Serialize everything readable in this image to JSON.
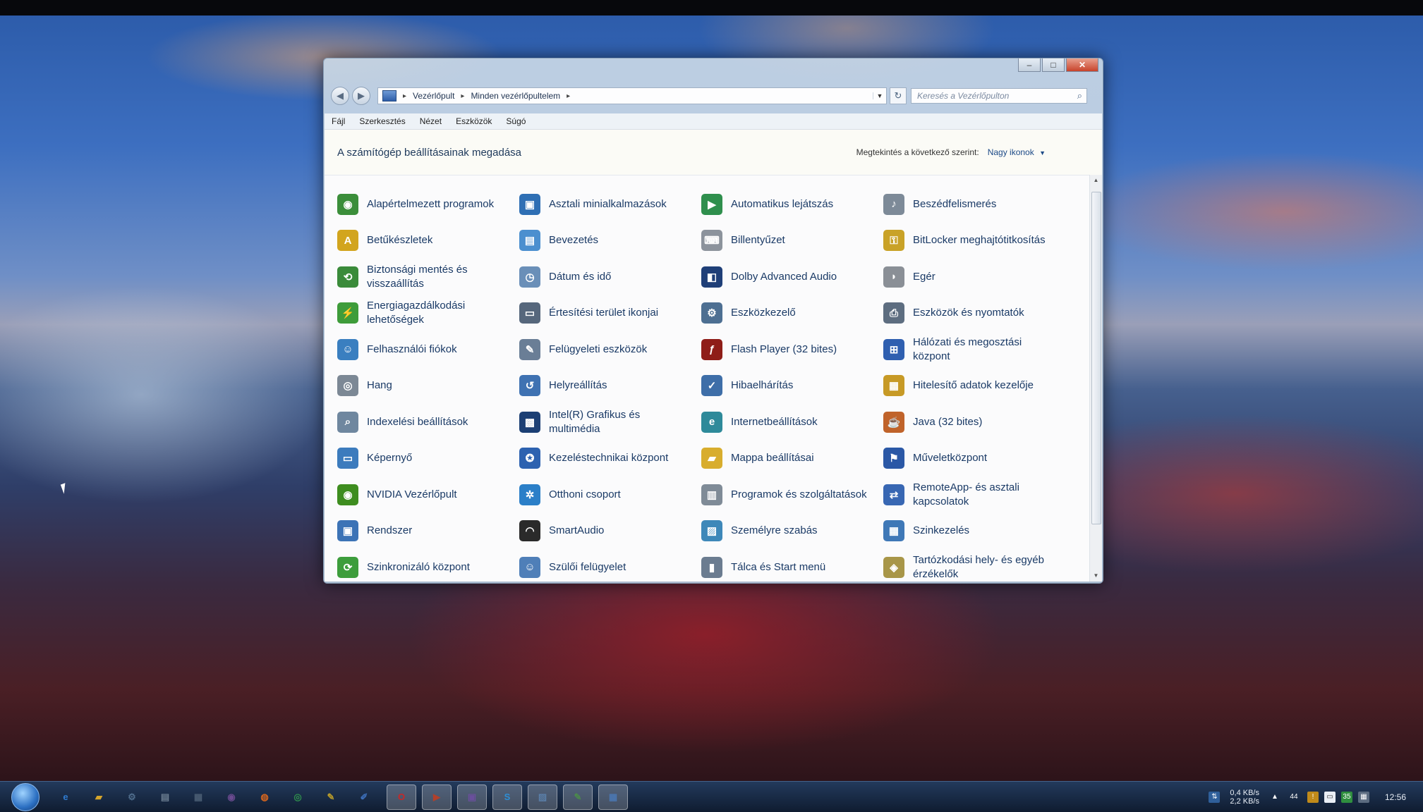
{
  "window": {
    "controls": {
      "minimize": "–",
      "maximize": "□",
      "close": "✕"
    },
    "nav": {
      "back": "◀",
      "forward": "▶"
    },
    "address": {
      "breadcrumbs": [
        "Vezérlőpult",
        "Minden vezérlőpultelem"
      ],
      "dropdown": "▼",
      "refresh": "↻"
    },
    "search": {
      "placeholder": "Keresés a Vezérlőpulton",
      "icon": "⌕"
    },
    "menu": [
      "Fájl",
      "Szerkesztés",
      "Nézet",
      "Eszközök",
      "Súgó"
    ],
    "header": {
      "title": "A számítógép beállításainak megadása",
      "view_label": "Megtekintés a következő szerint:",
      "view_value": "Nagy ikonok",
      "view_chevron": "▼"
    },
    "items": [
      {
        "label": "Alapértelmezett programok",
        "icon": "default-programs-icon",
        "color": "#3b8e3a",
        "glyph": "◉"
      },
      {
        "label": "Asztali minialkalmazások",
        "icon": "gadgets-icon",
        "color": "#2f6fb4",
        "glyph": "▣"
      },
      {
        "label": "Automatikus lejátszás",
        "icon": "autoplay-icon",
        "color": "#2f8f4d",
        "glyph": "▶"
      },
      {
        "label": "Beszédfelismerés",
        "icon": "microphone-icon",
        "color": "#7d8a98",
        "glyph": "♪"
      },
      {
        "label": "Betűkészletek",
        "icon": "fonts-icon",
        "color": "#d2a51e",
        "glyph": "A"
      },
      {
        "label": "Bevezetés",
        "icon": "getting-started-icon",
        "color": "#4b8fcf",
        "glyph": "▤"
      },
      {
        "label": "Billentyűzet",
        "icon": "keyboard-icon",
        "color": "#8c939c",
        "glyph": "⌨"
      },
      {
        "label": "BitLocker meghajtótitkosítás",
        "icon": "bitlocker-icon",
        "color": "#c9a227",
        "glyph": "⚿"
      },
      {
        "label": "Biztonsági mentés és visszaállítás",
        "icon": "backup-icon",
        "color": "#3a8b3a",
        "glyph": "⟲"
      },
      {
        "label": "Dátum és idő",
        "icon": "date-time-icon",
        "color": "#6a8fb8",
        "glyph": "◷"
      },
      {
        "label": "Dolby Advanced Audio",
        "icon": "dolby-icon",
        "color": "#1f3f78",
        "glyph": "◧"
      },
      {
        "label": "Egér",
        "icon": "mouse-icon",
        "color": "#8a8f96",
        "glyph": "◗"
      },
      {
        "label": "Energiagazdálkodási lehetőségek",
        "icon": "power-options-icon",
        "color": "#3e9c3a",
        "glyph": "⚡"
      },
      {
        "label": "Értesítési terület ikonjai",
        "icon": "notification-icons-icon",
        "color": "#56677c",
        "glyph": "▭"
      },
      {
        "label": "Eszközkezelő",
        "icon": "device-manager-icon",
        "color": "#4d6f92",
        "glyph": "⚙"
      },
      {
        "label": "Eszközök és nyomtatók",
        "icon": "printer-icon",
        "color": "#5d6d80",
        "glyph": "⎙"
      },
      {
        "label": "Felhasználói fiókok",
        "icon": "user-accounts-icon",
        "color": "#3a7fc0",
        "glyph": "☺"
      },
      {
        "label": "Felügyeleti eszközök",
        "icon": "admin-tools-icon",
        "color": "#6a7e96",
        "glyph": "✎"
      },
      {
        "label": "Flash Player (32 bites)",
        "icon": "flash-icon",
        "color": "#8f1d18",
        "glyph": "ƒ"
      },
      {
        "label": "Hálózati és megosztási központ",
        "icon": "network-icon",
        "color": "#2f5fb0",
        "glyph": "⊞"
      },
      {
        "label": "Hang",
        "icon": "sound-icon",
        "color": "#7c8895",
        "glyph": "◎"
      },
      {
        "label": "Helyreállítás",
        "icon": "recovery-icon",
        "color": "#3f72b2",
        "glyph": "↺"
      },
      {
        "label": "Hibaelhárítás",
        "icon": "troubleshooting-icon",
        "color": "#3e6ea8",
        "glyph": "✓"
      },
      {
        "label": "Hitelesítő adatok kezelője",
        "icon": "credential-manager-icon",
        "color": "#c79a26",
        "glyph": "▦"
      },
      {
        "label": "Indexelési beállítások",
        "icon": "indexing-icon",
        "color": "#6f879f",
        "glyph": "⌕"
      },
      {
        "label": "Intel(R) Grafikus és multimédia",
        "icon": "intel-graphics-icon",
        "color": "#1c3f74",
        "glyph": "▩"
      },
      {
        "label": "Internetbeállítások",
        "icon": "internet-options-icon",
        "color": "#2e8a9a",
        "glyph": "e"
      },
      {
        "label": "Java (32 bites)",
        "icon": "java-icon",
        "color": "#c0632a",
        "glyph": "☕"
      },
      {
        "label": "Képernyő",
        "icon": "display-icon",
        "color": "#3c7bbd",
        "glyph": "▭"
      },
      {
        "label": "Kezeléstechnikai központ",
        "icon": "ease-of-access-icon",
        "color": "#2d62b0",
        "glyph": "✪"
      },
      {
        "label": "Mappa beállításai",
        "icon": "folder-options-icon",
        "color": "#d8ad2d",
        "glyph": "▰"
      },
      {
        "label": "Műveletközpont",
        "icon": "action-center-icon",
        "color": "#2b58a6",
        "glyph": "⚑"
      },
      {
        "label": "NVIDIA Vezérlőpult",
        "icon": "nvidia-icon",
        "color": "#3e8d1f",
        "glyph": "◉"
      },
      {
        "label": "Otthoni csoport",
        "icon": "homegroup-icon",
        "color": "#2b7fc8",
        "glyph": "✲"
      },
      {
        "label": "Programok és szolgáltatások",
        "icon": "programs-features-icon",
        "color": "#7f8b97",
        "glyph": "▥"
      },
      {
        "label": "RemoteApp- és asztali kapcsolatok",
        "icon": "remoteapp-icon",
        "color": "#3867b3",
        "glyph": "⇄"
      },
      {
        "label": "Rendszer",
        "icon": "system-icon",
        "color": "#3c73b6",
        "glyph": "▣"
      },
      {
        "label": "SmartAudio",
        "icon": "smartaudio-icon",
        "color": "#2a2a2a",
        "glyph": "◠"
      },
      {
        "label": "Személyre szabás",
        "icon": "personalization-icon",
        "color": "#3e88b9",
        "glyph": "▨"
      },
      {
        "label": "Szinkezelés",
        "icon": "color-management-icon",
        "color": "#3f78b7",
        "glyph": "▦"
      },
      {
        "label": "Szinkronizáló központ",
        "icon": "sync-center-icon",
        "color": "#3d9d3c",
        "glyph": "⟳"
      },
      {
        "label": "Szülői felügyelet",
        "icon": "parental-controls-icon",
        "color": "#4f7fb8",
        "glyph": "☺"
      },
      {
        "label": "Tálca és Start menü",
        "icon": "taskbar-start-icon",
        "color": "#6b7c90",
        "glyph": "▮"
      },
      {
        "label": "Tartózkodási hely- és egyéb érzékelők",
        "icon": "location-sensors-icon",
        "color": "#a89648",
        "glyph": "◈"
      }
    ]
  },
  "taskbar": {
    "apps": [
      {
        "name": "internet-explorer-icon",
        "glyph": "e",
        "color": "#2f7bd0"
      },
      {
        "name": "explorer-folder-icon",
        "glyph": "▰",
        "color": "#d5a52b"
      },
      {
        "name": "network-tool-icon",
        "glyph": "⚙",
        "color": "#4f6d8c"
      },
      {
        "name": "notepad-icon",
        "glyph": "▤",
        "color": "#6b7d90"
      },
      {
        "name": "calendar-icon",
        "glyph": "▦",
        "color": "#495c72"
      },
      {
        "name": "media-center-icon",
        "glyph": "◉",
        "color": "#6b4b90"
      },
      {
        "name": "firefox-icon",
        "glyph": "◍",
        "color": "#d6661e"
      },
      {
        "name": "chrome-icon",
        "glyph": "◎",
        "color": "#2f8f4d"
      },
      {
        "name": "tool-icon",
        "glyph": "✎",
        "color": "#b89b2a"
      },
      {
        "name": "paint-icon",
        "glyph": "✐",
        "color": "#3c6eb8"
      },
      {
        "name": "opera-icon",
        "glyph": "O",
        "color": "#c62828"
      },
      {
        "name": "media-player-icon",
        "glyph": "▶",
        "color": "#b2402a"
      },
      {
        "name": "disk-tool-icon",
        "glyph": "▣",
        "color": "#6a4f9c"
      },
      {
        "name": "skype-icon",
        "glyph": "S",
        "color": "#2d8fd6"
      },
      {
        "name": "photos-icon",
        "glyph": "▨",
        "color": "#5a7ea8"
      },
      {
        "name": "editor-icon",
        "glyph": "✎",
        "color": "#4b8a4b"
      },
      {
        "name": "control-panel-icon",
        "glyph": "▦",
        "color": "#4a76b0"
      }
    ],
    "tray": {
      "upload_speed": "0,4 KB/s",
      "download_speed": "2,2 KB/s",
      "expand": "▲",
      "volume_level": "44",
      "badge": "35",
      "time": "12:56"
    }
  }
}
